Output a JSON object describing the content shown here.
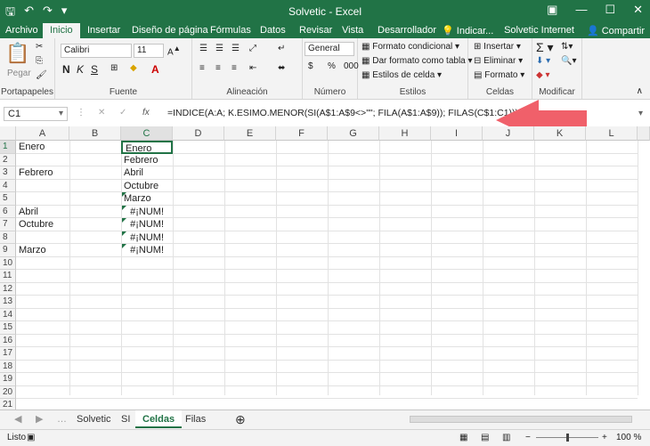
{
  "window": {
    "title": "Solvetic - Excel"
  },
  "tabs": [
    "Archivo",
    "Inicio",
    "Insertar",
    "Diseño de página",
    "Fórmulas",
    "Datos",
    "Revisar",
    "Vista",
    "Desarrollador"
  ],
  "tell_me": "Indicar...",
  "account": "Solvetic Internet",
  "share": "Compartir",
  "ribbon": {
    "clipboard": {
      "paste": "Pegar",
      "label": "Portapapeles"
    },
    "font": {
      "name": "Calibri",
      "size": "11",
      "label": "Fuente"
    },
    "alignment": {
      "label": "Alineación"
    },
    "number": {
      "format": "General",
      "label": "Número"
    },
    "styles": {
      "conditional": "Formato condicional",
      "table": "Dar formato como tabla",
      "cell_styles": "Estilos de celda",
      "label": "Estilos"
    },
    "cells": {
      "insert": "Insertar",
      "delete": "Eliminar",
      "format": "Formato",
      "label": "Celdas"
    },
    "editing": {
      "label": "Modificar"
    }
  },
  "formula_bar": {
    "namebox": "C1",
    "fx": "fx",
    "formula": "=INDICE(A:A; K.ESIMO.MENOR(SI(A$1:A$9<>\"\"; FILA(A$1:A$9)); FILAS(C$1:C1)))"
  },
  "columns": [
    "A",
    "B",
    "C",
    "D",
    "E",
    "F",
    "G",
    "H",
    "I",
    "J",
    "K",
    "L"
  ],
  "rows": [
    "1",
    "2",
    "3",
    "4",
    "5",
    "6",
    "7",
    "8",
    "9",
    "10",
    "11",
    "12",
    "13",
    "14",
    "15",
    "16",
    "17",
    "18",
    "19",
    "20",
    "21"
  ],
  "cells": {
    "A1": "Enero",
    "A3": "Febrero",
    "A6": "Abril",
    "A7": "Octubre",
    "A9": "Marzo",
    "C1": "Enero",
    "C2": "Febrero",
    "C3": "Abril",
    "C4": "Octubre",
    "C5": "Marzo",
    "C6": "#¡NUM!",
    "C7": "#¡NUM!",
    "C8": "#¡NUM!",
    "C9": "#¡NUM!"
  },
  "sheets": [
    "Solvetic",
    "SI",
    "Celdas",
    "Filas"
  ],
  "active_sheet": "Celdas",
  "status": {
    "ready": "Listo",
    "zoom": "100 %"
  },
  "colors": {
    "excel_green": "#217346",
    "arrow_red": "#f0606a"
  }
}
